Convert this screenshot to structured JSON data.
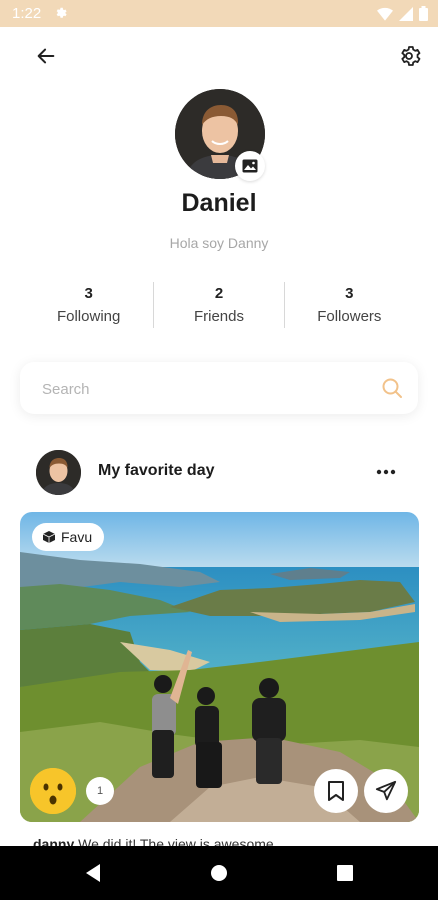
{
  "status_bar": {
    "time": "1:22"
  },
  "profile": {
    "name": "Daniel",
    "bio": "Hola soy Danny",
    "stats": [
      {
        "count": "3",
        "label": "Following"
      },
      {
        "count": "2",
        "label": "Friends"
      },
      {
        "count": "3",
        "label": "Followers"
      }
    ]
  },
  "search": {
    "placeholder": "Search",
    "value": ""
  },
  "post": {
    "title": "My favorite day",
    "tag": "Favu",
    "reaction_count": "1",
    "caption_user": "danny",
    "caption_text": "We did it! The view is awesome"
  },
  "colors": {
    "accent": "#f2c28a",
    "status_bar": "#f2d9b8",
    "reaction": "#f7c52a"
  }
}
